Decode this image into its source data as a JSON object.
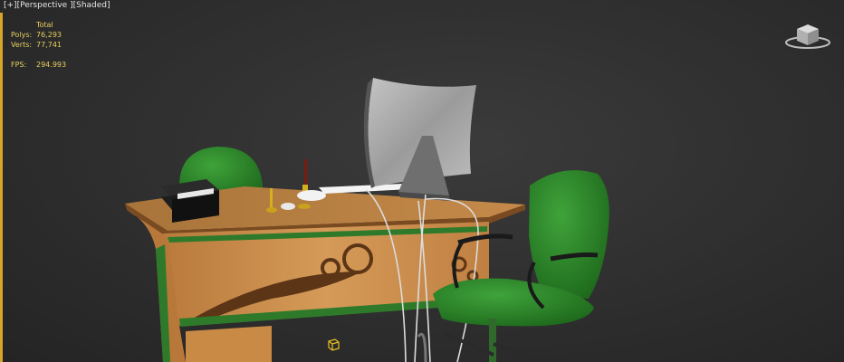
{
  "viewport": {
    "label_parts": [
      "[+]",
      " [Perspective ]",
      " [Shaded]"
    ]
  },
  "stats": {
    "total_label": "Total",
    "polys_label": "Polys:",
    "polys_value": "76,293",
    "verts_label": "Verts:",
    "verts_value": "77,741",
    "fps_label": "FPS:",
    "fps_value": "294.993"
  },
  "colors": {
    "active_viewport_border": "#d6a62a",
    "stats_text": "#e8d060",
    "chair_green": "#2f8a2a",
    "desk_wood": "#c98a46"
  },
  "icons": {
    "viewcube": "viewcube-icon",
    "pivot": "pivot-gizmo-icon"
  }
}
